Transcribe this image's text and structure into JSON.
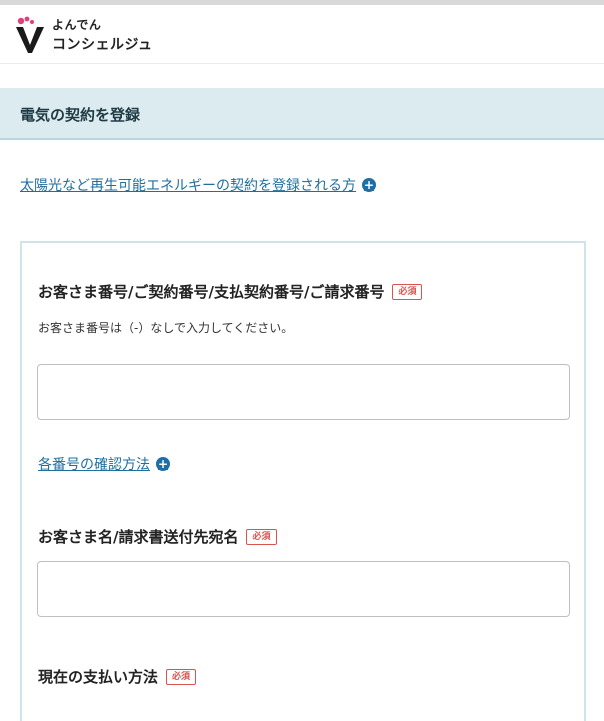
{
  "header": {
    "logo_line1": "よんでん",
    "logo_line2": "コンシェルジュ"
  },
  "section": {
    "title": "電気の契約を登録"
  },
  "renewable_link": {
    "label": "太陽光など再生可能エネルギーの契約を登録される方"
  },
  "form": {
    "customer_number": {
      "label": "お客さま番号/ご契約番号/支払契約番号/ご請求番号",
      "required": "必須",
      "hint": "お客さま番号は（-）なしで入力してください。",
      "value": "",
      "placeholder": ""
    },
    "number_check_link": {
      "label": "各番号の確認方法"
    },
    "customer_name": {
      "label": "お客さま名/請求書送付先宛名",
      "required": "必須",
      "value": "",
      "placeholder": ""
    },
    "payment_method": {
      "label": "現在の支払い方法",
      "required": "必須"
    }
  },
  "colors": {
    "section_bg": "#dcebef",
    "link": "#1f6f9e",
    "plus_icon": "#1d6fa5",
    "required": "#d9534f",
    "card_border": "#cfe4ea"
  },
  "icons": {
    "plus": "plus-circle-icon",
    "logo": "yonden-logo-icon"
  }
}
